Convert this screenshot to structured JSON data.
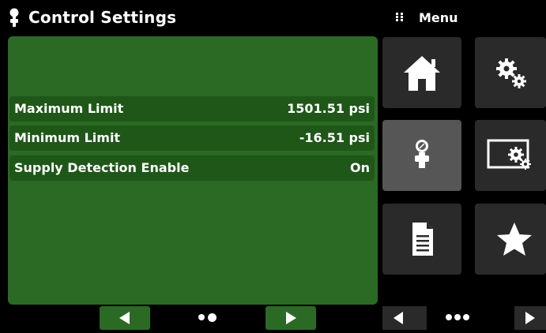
{
  "title_bar": {
    "title": "Control Settings",
    "icon": "regulator-icon"
  },
  "settings": [
    {
      "label": "Maximum Limit",
      "value": "1501.51 psi"
    },
    {
      "label": "Minimum Limit",
      "value": "-16.51 psi"
    },
    {
      "label": "Supply Detection Enable",
      "value": "On"
    }
  ],
  "left_nav": {
    "prev_icon": "arrow-left-icon",
    "next_icon": "arrow-right-icon",
    "page_count": 2,
    "current_page": 2
  },
  "menu": {
    "label": "Menu",
    "tiles": [
      {
        "icon": "home-icon",
        "active": false
      },
      {
        "icon": "gears-icon",
        "active": false
      },
      {
        "icon": "regulator-icon",
        "active": true
      },
      {
        "icon": "display-settings-icon",
        "active": false
      },
      {
        "icon": "document-icon",
        "active": false
      },
      {
        "icon": "star-icon",
        "active": false
      }
    ],
    "page_count": 3
  },
  "colors": {
    "panel_green": "#2b6a24",
    "row_green": "#1f5719",
    "tile": "#2a2a2a",
    "tile_active": "#565656",
    "icon": "#ffffff"
  }
}
